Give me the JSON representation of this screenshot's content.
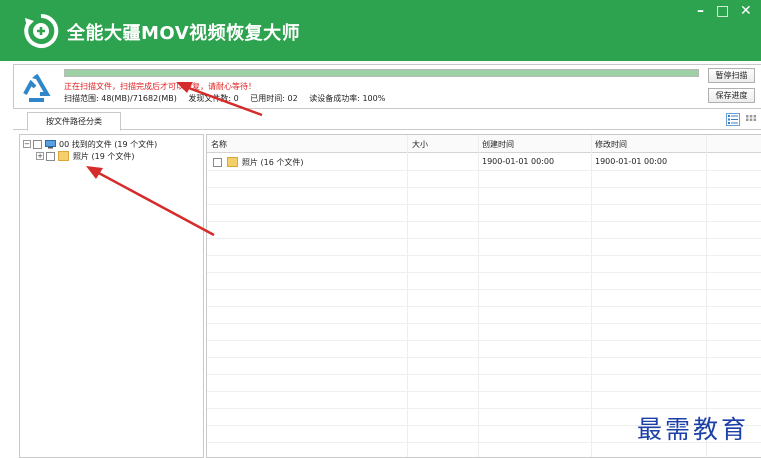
{
  "window": {
    "title": "全能大疆MOV视频恢复大师",
    "minimize": "–",
    "maximize": "□",
    "close": "✕"
  },
  "scan": {
    "progress_percent": 100,
    "status_text": "正在扫描文件，扫描完成后才可以恢复，请耐心等待！",
    "range_text": "扫描范围: 48(MB)/71682(MB)",
    "found_text": "发现文件数: 0",
    "elapsed_text": "已用时间: 02",
    "success_text": "读设备成功率: 100%",
    "pause_button": "暂停扫描",
    "save_button": "保存进度"
  },
  "tabs": {
    "path_tab": "按文件路径分类"
  },
  "tree": {
    "root_label": "00 找到的文件 (19 个文件)",
    "child_label": "照片    (19 个文件)"
  },
  "list": {
    "columns": [
      "名称",
      "大小",
      "创建时间",
      "修改时间"
    ],
    "rows": [
      {
        "name": "照片    (16 个文件)",
        "size": "",
        "created": "1900-01-01 00:00",
        "modified": "1900-01-01 00:00"
      }
    ]
  },
  "watermark": "最需教育",
  "colors": {
    "titlebar": "#2ea34f",
    "status_red": "#e02020",
    "annotation_arrow": "#d62b2b",
    "watermark": "#1c3fa8"
  },
  "icons": {
    "logo": "recovery-plus-icon",
    "scan": "recycle-arrows-icon",
    "detail_view": "list-view-icon",
    "thumb_view": "grid-view-icon",
    "folder": "folder-icon"
  }
}
